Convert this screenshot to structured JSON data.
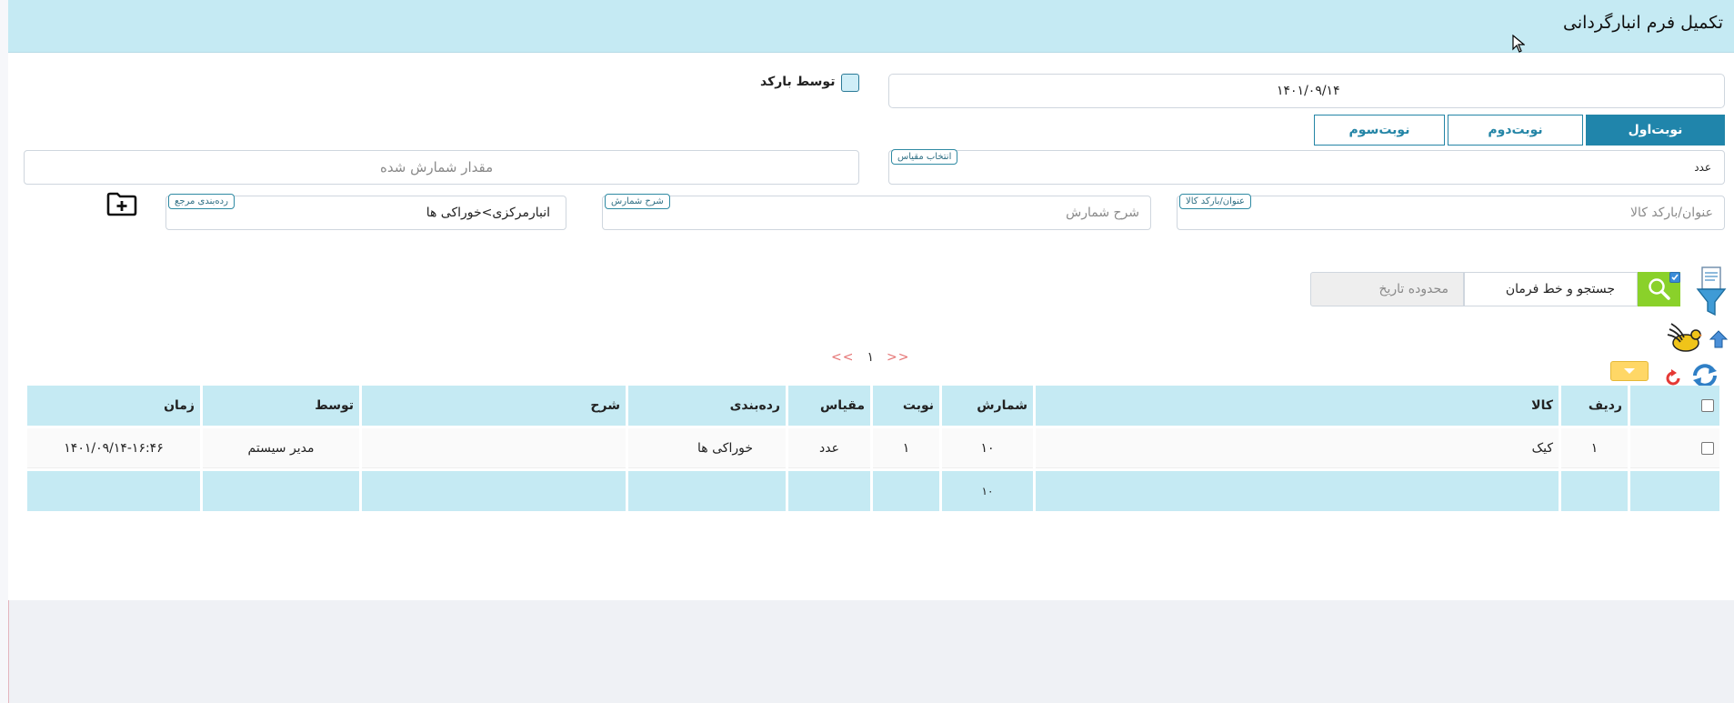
{
  "header": {
    "title": "تکمیل فرم انبارگردانی"
  },
  "form": {
    "date_value": "۱۴۰۱/۰۹/۱۴",
    "barcode_label": "توسط بارکد",
    "shifts": [
      "نوبت‌اول",
      "نوبت‌دوم",
      "نوبت‌سوم"
    ],
    "active_shift": "نوبت‌اول",
    "unit_tag": "انتخاب مقیاس",
    "unit_value": "عدد",
    "count_placeholder": "مقدار شمارش شده",
    "product_tag": "عنوان/بارکد کالا",
    "product_placeholder": "عنوان/بارکد کالا",
    "desc_tag": "شرح شمارش",
    "desc_placeholder": "شرح شمارش",
    "category_tag": "رده‌بندی مرجع",
    "category_value": "انبارمرکزی>خوراکی ها"
  },
  "search": {
    "command_value": "جستجو و خط فرمان",
    "date_range_placeholder": "محدوده تاریخ"
  },
  "pager": {
    "prev": "<<",
    "page": "۱",
    "next": ">>"
  },
  "table": {
    "headers": {
      "row": "ردیف",
      "product": "کالا",
      "count": "شمارش",
      "shift": "نوبت",
      "unit": "مقیاس",
      "category": "رده‌بندی",
      "desc": "شرح",
      "by": "توسط",
      "time": "زمان"
    },
    "rows": [
      {
        "row": "۱",
        "product": "کیک",
        "count": "۱۰",
        "shift": "۱",
        "unit": "عدد",
        "category": "خوراکی ها",
        "desc": "",
        "by": "مدیر سیستم",
        "time": "۱۴۰۱/۰۹/۱۴-۱۶:۴۶"
      }
    ],
    "footer": {
      "count_total": "۱۰"
    }
  },
  "colors": {
    "header_bg": "#c5eaf3",
    "accent": "#2085ab",
    "search_button": "#8ad12a",
    "dropdown_toggle": "#ffd766",
    "pager_arrows": "#e57373"
  },
  "icons": {
    "add_folder": "folder-plus-icon",
    "filter": "filter-funnel-icon",
    "search": "magnifier-icon",
    "bird": "bird-icon",
    "upload": "upload-arrow-icon",
    "reset": "reset-icon",
    "refresh": "refresh-icon",
    "dropdown": "caret-down-icon"
  }
}
